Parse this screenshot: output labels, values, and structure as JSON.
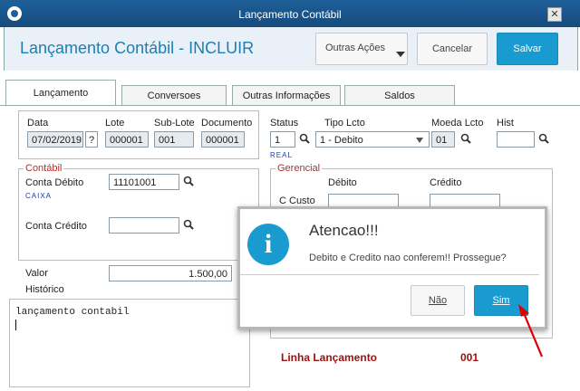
{
  "window": {
    "title": "Lançamento Contábil"
  },
  "header": {
    "page_title": "Lançamento Contábil - INCLUIR",
    "other_actions": "Outras Ações",
    "cancel": "Cancelar",
    "save": "Salvar"
  },
  "tabs": [
    "Lançamento",
    "Conversoes",
    "Outras Informações",
    "Saldos"
  ],
  "form": {
    "data_label": "Data",
    "data_value": "07/02/2019",
    "help_btn": "?",
    "lote_label": "Lote",
    "lote_value": "000001",
    "sublote_label": "Sub-Lote",
    "sublote_value": "001",
    "documento_label": "Documento",
    "documento_value": "000001",
    "status_label": "Status",
    "status_value": "1",
    "tipo_label": "Tipo Lcto",
    "tipo_value": "1 - Debito",
    "moeda_label": "Moeda Lcto",
    "moeda_value": "01",
    "moeda_note": "REAL",
    "hist_label": "Hist",
    "hist_value": ""
  },
  "contabil": {
    "legend": "Contábil",
    "conta_debito_label": "Conta Débito",
    "conta_debito_value": "11101001",
    "conta_debito_note": "CAIXA",
    "conta_credito_label": "Conta Crédito",
    "conta_credito_value": ""
  },
  "gerencial": {
    "legend": "Gerencial",
    "debito_label": "Débito",
    "credito_label": "Crédito",
    "ccusto_label": "C Custo"
  },
  "valor": {
    "label": "Valor",
    "value": "1.500,00"
  },
  "historico": {
    "label": "Histórico",
    "text": "lançamento contabil"
  },
  "linha": {
    "label": "Linha Lançamento",
    "value": "001"
  },
  "dialog": {
    "title": "Atencao!!!",
    "message": "Debito e Credito nao conferem!! Prossegue?",
    "no": "Não",
    "yes": "Sim",
    "icon_glyph": "i"
  },
  "colors": {
    "accent": "#1a9bd0",
    "title_bar": "#1e5f99",
    "legend": "#b03030",
    "arrow": "#e00000"
  }
}
